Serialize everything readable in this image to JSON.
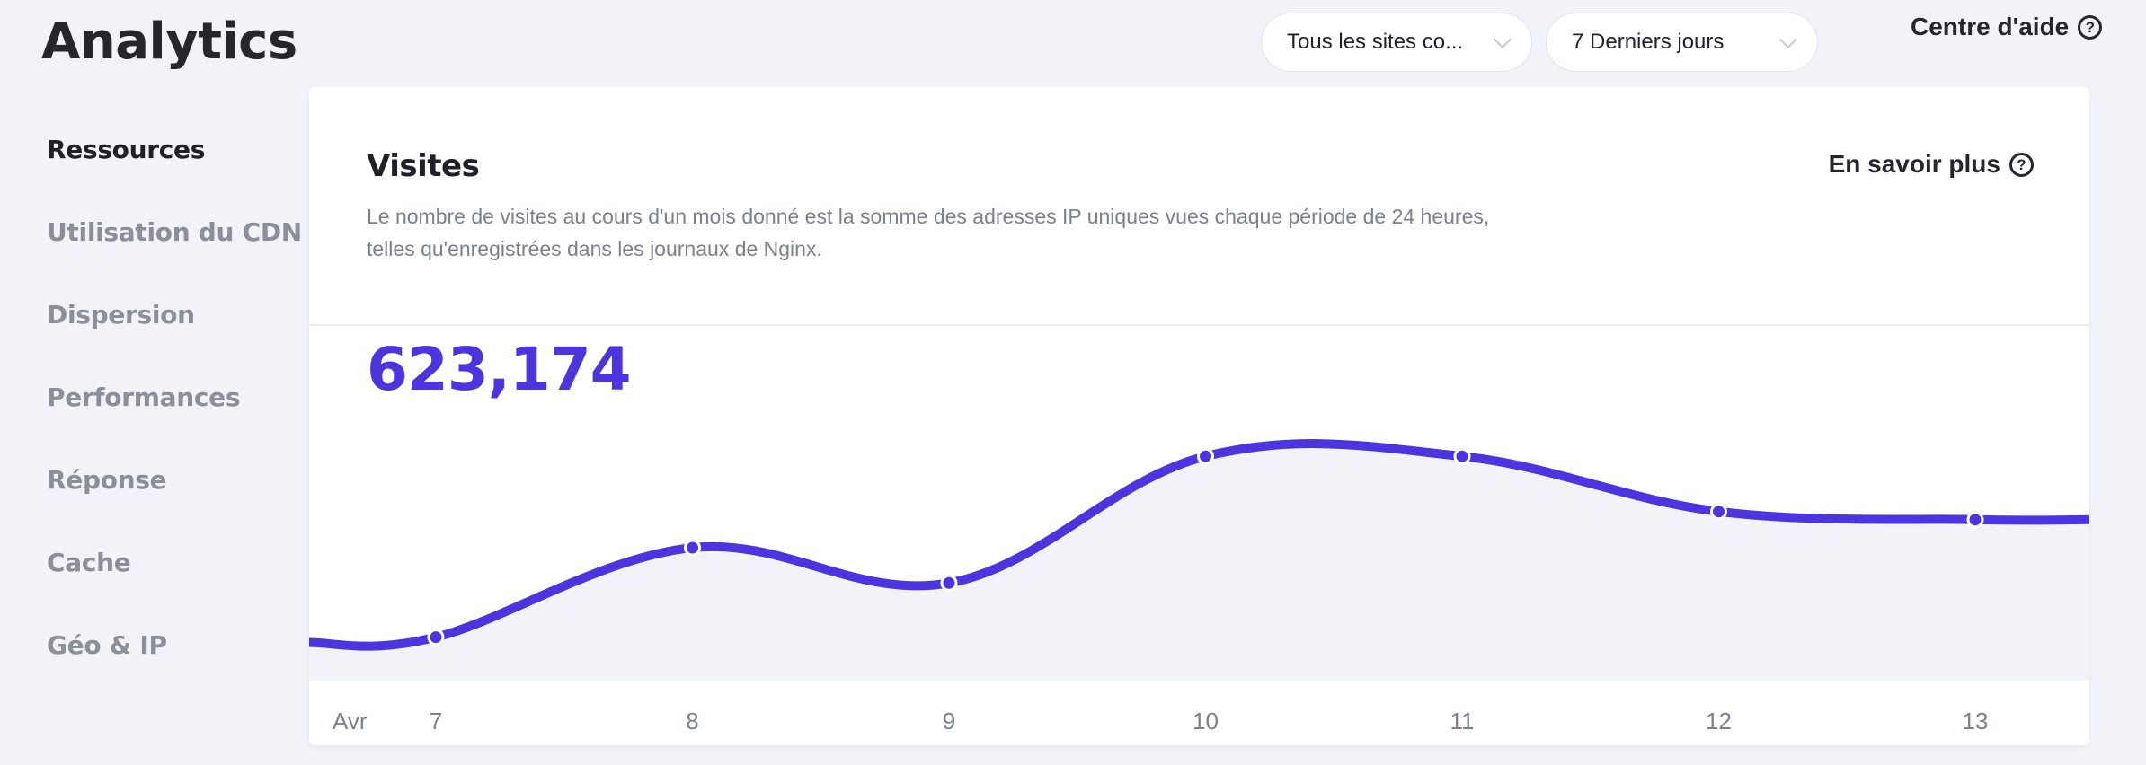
{
  "app": {
    "title": "Analytics"
  },
  "header": {
    "site_filter": {
      "selected": "Tous les sites co..."
    },
    "period_filter": {
      "selected": "7 Derniers jours"
    },
    "help_label": "Centre d'aide",
    "help_icon": "question-circle-icon"
  },
  "sidebar": {
    "items": [
      {
        "label": "Ressources",
        "active": true
      },
      {
        "label": "Utilisation du CDN",
        "active": false
      },
      {
        "label": "Dispersion",
        "active": false
      },
      {
        "label": "Performances",
        "active": false
      },
      {
        "label": "Réponse",
        "active": false
      },
      {
        "label": "Cache",
        "active": false
      },
      {
        "label": "Géo & IP",
        "active": false
      }
    ]
  },
  "card": {
    "title": "Visites",
    "description": "Le nombre de visites au cours d'un mois donné est la somme des adresses IP uniques vues chaque période de 24 heures, telles qu'enregistrées dans les journaux de Nginx.",
    "learn_more_label": "En savoir plus",
    "total": "623,174"
  },
  "colors": {
    "accent": "#4c35de",
    "fill": "#f2f3f8",
    "muted_text": "#7c808a"
  },
  "chart_data": {
    "type": "area",
    "title": "Visites",
    "xlabel": "Avr",
    "ylabel": "",
    "x": [
      "7",
      "8",
      "9",
      "10",
      "11",
      "12",
      "13"
    ],
    "series": [
      {
        "name": "Visites",
        "values": [
          25700,
          78700,
          57800,
          132800,
          132800,
          100100,
          95300
        ]
      }
    ],
    "ylim": [
      0,
      210000
    ],
    "grid": false,
    "legend": "none"
  }
}
